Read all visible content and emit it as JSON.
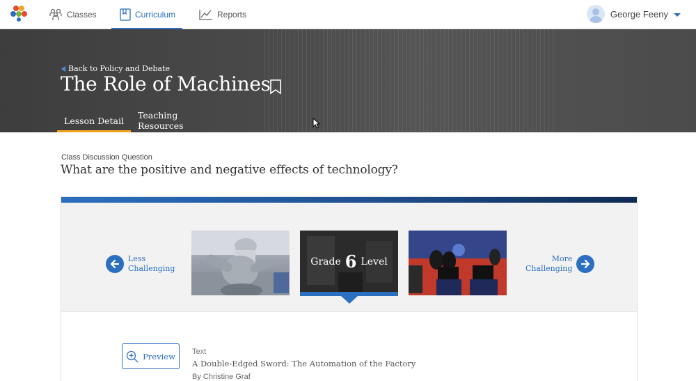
{
  "nav": {
    "classes_label": "Classes",
    "curriculum_label": "Curriculum",
    "reports_label": "Reports",
    "user_name": "George Feeny"
  },
  "colors": {
    "accent": "#2c6fc0",
    "tab_active": "#f5a623",
    "hero_bg": "#4a4a4a"
  },
  "hero": {
    "back_label": "Back to Policy and Debate",
    "title": "The Role of Machines",
    "tabs": [
      {
        "label": "Lesson Detail",
        "active": true
      },
      {
        "label": "Teaching Resources",
        "active": false
      }
    ]
  },
  "discussion": {
    "label": "Class Discussion Question",
    "question": "What are the positive and negative effects of technology?"
  },
  "levels": {
    "less_line1": "Less",
    "less_line2": "Challenging",
    "more_line1": "More",
    "more_line2": "Challenging",
    "grade_prefix": "Grade",
    "grade_number": "6",
    "grade_suffix": "Level"
  },
  "resource": {
    "preview_label": "Preview",
    "type": "Text",
    "title": "A Double-Edged Sword: The Automation of the Factory",
    "author": "By Christine Graf"
  }
}
